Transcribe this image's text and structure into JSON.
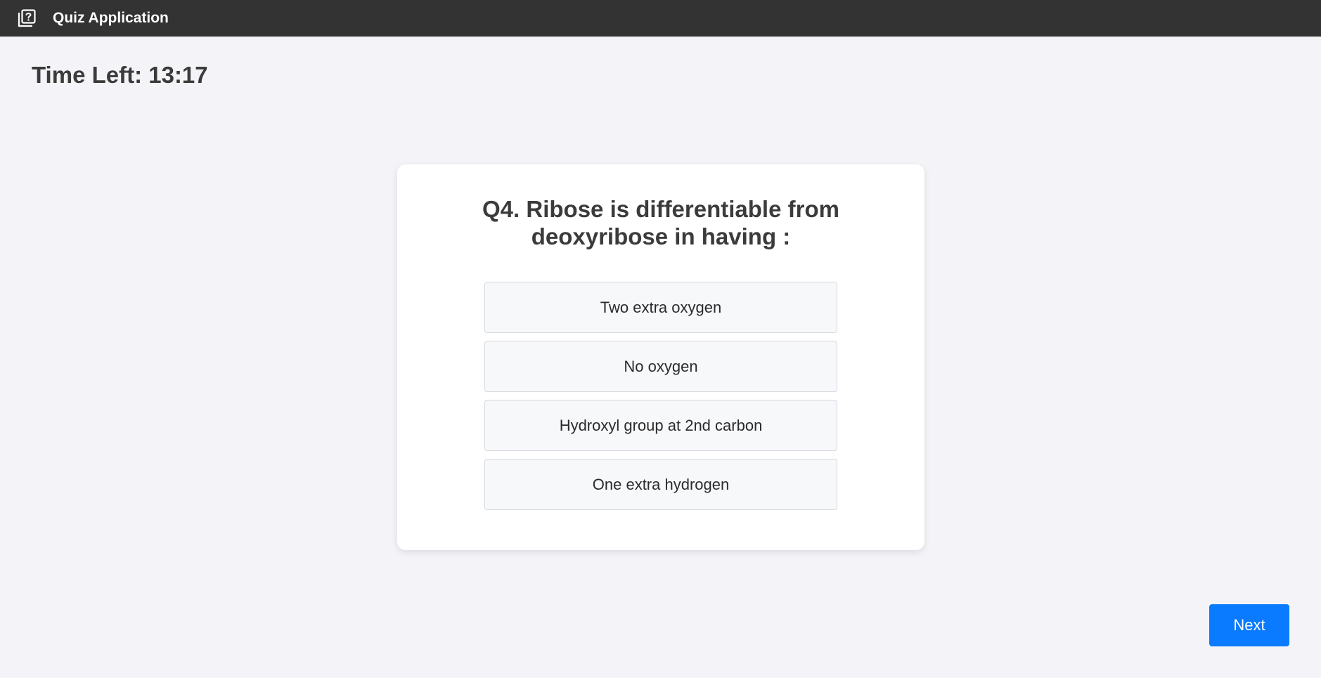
{
  "header": {
    "title": "Quiz Application",
    "icon": "quiz-question-icon",
    "background_color": "#333333"
  },
  "timer": {
    "text": "Time Left: 13:17"
  },
  "question": {
    "text": "Q4. Ribose is differentiable from deoxyribose in having :",
    "options": [
      "Two extra oxygen",
      "No oxygen",
      "Hydroxyl group at 2nd carbon",
      "One extra hydrogen"
    ]
  },
  "navigation": {
    "next_label": "Next",
    "accent_color": "#0a7bff"
  }
}
